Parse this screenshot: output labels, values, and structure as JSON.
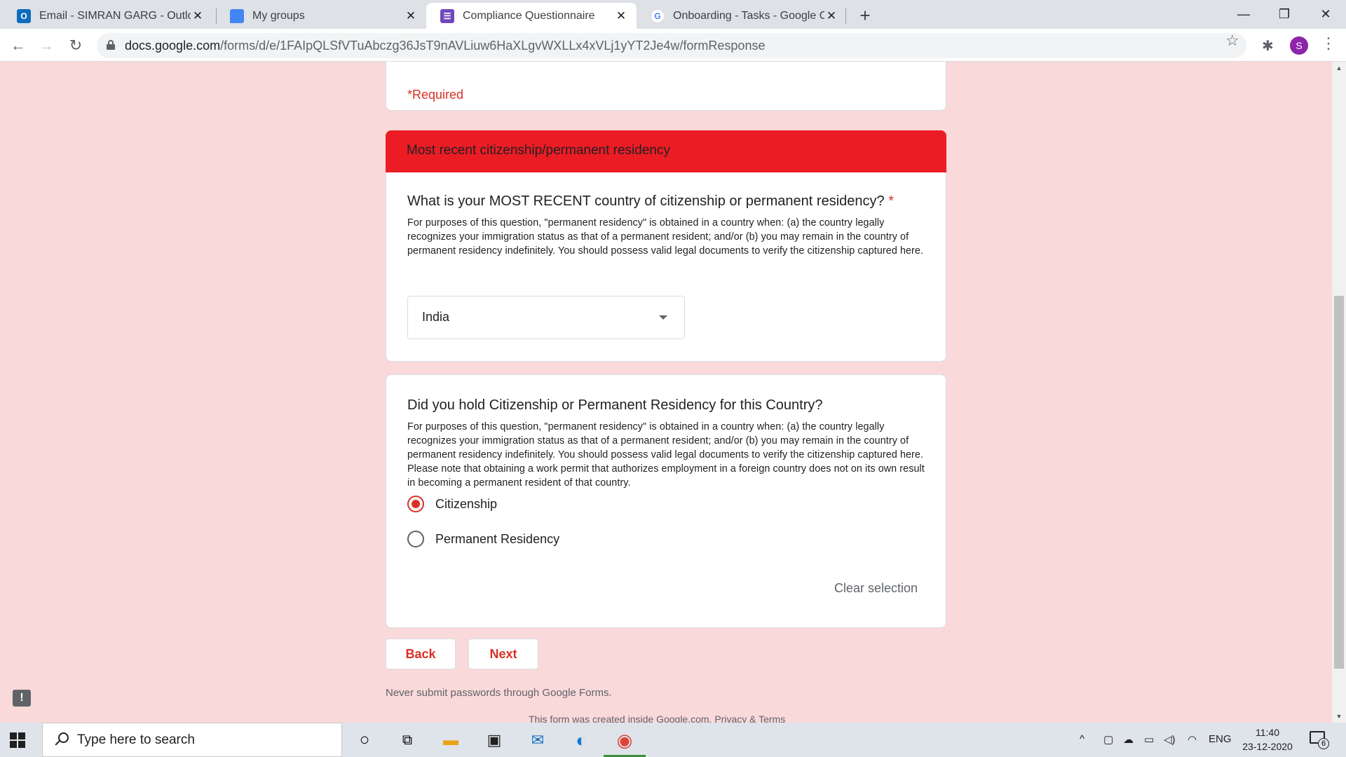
{
  "browser": {
    "tabs": [
      {
        "title": "Email - SIMRAN GARG - Outlook",
        "icon": "outlook-icon"
      },
      {
        "title": "My groups",
        "icon": "groups-icon"
      },
      {
        "title": "Compliance Questionnaire",
        "icon": "forms-icon",
        "active": true
      },
      {
        "title": "Onboarding - Tasks - Google Car",
        "icon": "google-icon"
      }
    ],
    "url_host": "docs.google.com",
    "url_path": "/forms/d/e/1FAIpQLSfVTuAbczg36JsT9nAVLiuw6HaXLgvWXLLx4xVLj1yYT2Je4w/formResponse",
    "profile_initial": "S"
  },
  "form": {
    "required_note": "*Required",
    "section_title": "Most recent citizenship/permanent residency",
    "q1": {
      "title": "What is your MOST RECENT country of citizenship or permanent residency?",
      "required_mark": "*",
      "description": "For purposes of this question, \"permanent residency\" is obtained in a country when: (a) the country legally recognizes your immigration status as that of a permanent resident; and/or (b) you may remain in the country of permanent residency indefinitely. You should possess valid legal documents to verify the citizenship captured here.",
      "selected": "India"
    },
    "q2": {
      "title": "Did you hold Citizenship or Permanent Residency for this Country?",
      "description": "For purposes of this question, \"permanent residency\" is obtained in a country when: (a) the country legally recognizes your immigration status as that of a permanent resident; and/or (b) you may remain in the country of permanent residency indefinitely. You should possess valid legal documents to verify the citizenship captured here. Please note that obtaining a work permit that authorizes employment in a foreign country does not on its own result in becoming a permanent resident of that country.",
      "options": [
        {
          "label": "Citizenship",
          "checked": true
        },
        {
          "label": "Permanent Residency",
          "checked": false
        }
      ],
      "clear_label": "Clear selection"
    },
    "back_label": "Back",
    "next_label": "Next",
    "password_note": "Never submit passwords through Google Forms.",
    "created_note": "This form was created inside Google.com. Privacy & Terms",
    "accent_color": "#d93025",
    "header_color": "#ec1c24",
    "background_color": "#fad9da"
  },
  "taskbar": {
    "search_placeholder": "Type here to search",
    "language": "ENG",
    "time": "11:40",
    "date": "23-12-2020",
    "notification_count": "6"
  }
}
